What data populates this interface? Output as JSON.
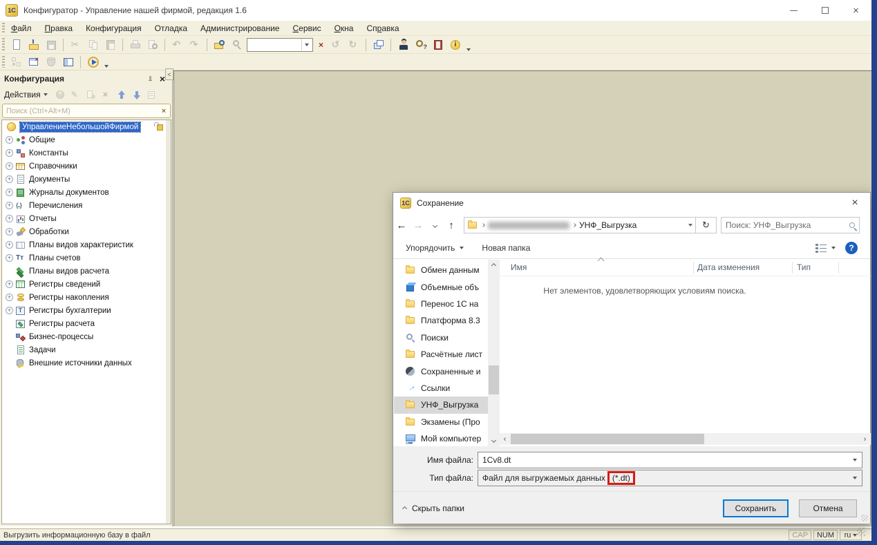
{
  "titlebar": {
    "title": "Конфигуратор - Управление нашей фирмой, редакция 1.6",
    "app_logo_text": "1С"
  },
  "menu": {
    "items": [
      {
        "label": "Файл",
        "u": 0,
        "name": "menu-file"
      },
      {
        "label": "Правка",
        "u": 0,
        "name": "menu-edit"
      },
      {
        "label": "Конфигурация",
        "u": -1,
        "name": "menu-configuration"
      },
      {
        "label": "Отладка",
        "u": -1,
        "name": "menu-debug"
      },
      {
        "label": "Администрирование",
        "u": -1,
        "name": "menu-administration"
      },
      {
        "label": "Сервис",
        "u": 0,
        "name": "menu-service"
      },
      {
        "label": "Окна",
        "u": 0,
        "name": "menu-windows"
      },
      {
        "label": "Справка",
        "u": 2,
        "name": "menu-help"
      }
    ]
  },
  "toolbars": {
    "row1a": [
      {
        "icon": "new-document",
        "name": "new-document-button"
      },
      {
        "icon": "open-folder",
        "name": "open-button"
      },
      {
        "icon": "save",
        "name": "save-button",
        "disabled": true
      },
      {
        "sep": true
      },
      {
        "icon": "cut",
        "name": "cut-button",
        "disabled": true
      },
      {
        "icon": "copy",
        "name": "copy-button",
        "disabled": true
      },
      {
        "icon": "paste",
        "name": "paste-button",
        "disabled": true
      },
      {
        "sep": true
      },
      {
        "icon": "print",
        "name": "print-button",
        "disabled": true
      },
      {
        "icon": "print-preview",
        "name": "print-preview-button",
        "disabled": true
      },
      {
        "sep": true
      },
      {
        "icon": "undo",
        "name": "undo-button",
        "disabled": true
      },
      {
        "icon": "redo",
        "name": "redo-button",
        "disabled": true
      },
      {
        "sep": true
      },
      {
        "icon": "find",
        "name": "find-button"
      },
      {
        "icon": "zoom",
        "name": "zoom-button",
        "disabled": true
      }
    ],
    "search_combo": {
      "value": ""
    },
    "row1b": [
      {
        "icon": "sync-back",
        "name": "search-previous-button",
        "disabled": true
      },
      {
        "icon": "sync-forward",
        "name": "search-next-button",
        "disabled": true
      },
      {
        "sep": true
      },
      {
        "icon": "window-copy",
        "name": "copy-window-button"
      },
      {
        "sep": true
      },
      {
        "icon": "syntax-check",
        "name": "syntax-check-button"
      },
      {
        "icon": "help-search",
        "name": "help-search-button"
      },
      {
        "icon": "help-book",
        "name": "help-contents-button"
      },
      {
        "icon": "info",
        "name": "about-button"
      }
    ],
    "row2": [
      {
        "icon": "metadata",
        "name": "configuration-tree-button",
        "disabled": true
      },
      {
        "icon": "interface-window",
        "name": "interface-editor-button"
      },
      {
        "icon": "database",
        "name": "database-button",
        "disabled": true
      },
      {
        "icon": "table",
        "name": "exchange-table-button"
      },
      {
        "sep": true
      },
      {
        "icon": "start-debug",
        "name": "start-debugging-button"
      }
    ]
  },
  "config_panel": {
    "title": "Конфигурация",
    "actions_label": "Действия",
    "actions": [
      {
        "icon": "add",
        "name": "add-button",
        "disabled": true
      },
      {
        "icon": "edit",
        "name": "edit-button",
        "disabled": true
      },
      {
        "icon": "copy-add",
        "name": "copy-item-button",
        "disabled": true
      },
      {
        "icon": "delete",
        "name": "delete-button",
        "disabled": true
      },
      {
        "icon": "move-up",
        "name": "move-up-button"
      },
      {
        "icon": "move-down",
        "name": "move-down-button"
      },
      {
        "icon": "show-list",
        "name": "show-in-list-button",
        "disabled": true
      }
    ],
    "search_placeholder": "Поиск (Ctrl+Alt+M)",
    "tree_root": "УправлениеНебольшойФирмой",
    "tree_items": [
      {
        "label": "Общие",
        "icon": "common",
        "expandable": true
      },
      {
        "label": "Константы",
        "icon": "constants",
        "expandable": true
      },
      {
        "label": "Справочники",
        "icon": "catalogs",
        "expandable": true
      },
      {
        "label": "Документы",
        "icon": "documents",
        "expandable": true
      },
      {
        "label": "Журналы документов",
        "icon": "document-journals",
        "expandable": true
      },
      {
        "label": "Перечисления",
        "icon": "enums",
        "expandable": true
      },
      {
        "label": "Отчеты",
        "icon": "reports",
        "expandable": true
      },
      {
        "label": "Обработки",
        "icon": "data-processors",
        "expandable": true
      },
      {
        "label": "Планы видов характеристик",
        "icon": "chart-of-characteristic-types",
        "expandable": true
      },
      {
        "label": "Планы счетов",
        "icon": "chart-of-accounts",
        "expandable": true
      },
      {
        "label": "Планы видов расчета",
        "icon": "chart-of-calculation-types",
        "expandable": false
      },
      {
        "label": "Регистры сведений",
        "icon": "information-registers",
        "expandable": true
      },
      {
        "label": "Регистры накопления",
        "icon": "accumulation-registers",
        "expandable": true
      },
      {
        "label": "Регистры бухгалтерии",
        "icon": "accounting-registers",
        "expandable": true
      },
      {
        "label": "Регистры расчета",
        "icon": "calculation-registers",
        "expandable": false
      },
      {
        "label": "Бизнес-процессы",
        "icon": "business-processes",
        "expandable": false
      },
      {
        "label": "Задачи",
        "icon": "tasks",
        "expandable": false
      },
      {
        "label": "Внешние источники данных",
        "icon": "external-data-sources",
        "expandable": false
      }
    ]
  },
  "dialog": {
    "title": "Сохранение",
    "nav": {
      "breadcrumb_folder": "УНФ_Выгрузка",
      "breadcrumb_redacted": true,
      "search_text": "Поиск: УНФ_Выгрузка"
    },
    "toolbar": {
      "organize": "Упорядочить",
      "new_folder": "Новая папка"
    },
    "sidebar": [
      {
        "label": "Обмен данным",
        "icon": "folder"
      },
      {
        "label": "Объемные объ",
        "icon": "3d-objects"
      },
      {
        "label": "Перенос 1С на",
        "icon": "folder"
      },
      {
        "label": "Платформа 8.3",
        "icon": "folder"
      },
      {
        "label": "Поиски",
        "icon": "search"
      },
      {
        "label": "Расчётные лист",
        "icon": "folder"
      },
      {
        "label": "Сохраненные и",
        "icon": "saved-games"
      },
      {
        "label": "Ссылки",
        "icon": "links"
      },
      {
        "label": "УНФ_Выгрузка",
        "icon": "folder",
        "selected": true
      },
      {
        "label": "Экзамены (Про",
        "icon": "folder"
      },
      {
        "label": "Мой компьютер",
        "icon": "computer"
      }
    ],
    "list": {
      "columns": [
        "Имя",
        "Дата изменения",
        "Тип"
      ],
      "empty_message": "Нет элементов, удовлетворяющих условиям поиска."
    },
    "fields": {
      "filename_label": "Имя файла:",
      "filename_value": "1Cv8.dt",
      "filetype_label": "Тип файла:",
      "filetype_value_prefix": "Файл для выгружаемых данных",
      "filetype_value_highlighted": "(*.dt)"
    },
    "footer": {
      "hide_folders": "Скрыть папки",
      "save": "Сохранить",
      "cancel": "Отмена"
    }
  },
  "statusbar": {
    "message": "Выгрузить информационную базу в файл",
    "cap": "CAP",
    "num": "NUM",
    "lang": "ru"
  },
  "colors": {
    "selection_blue": "#2e66c8",
    "annotation_red": "#d81a12",
    "default_button_border": "#0078d7",
    "window_border_blue": "#24418e",
    "workspace_khaki": "#d5d1b8",
    "chrome_cream": "#f3f0df"
  }
}
